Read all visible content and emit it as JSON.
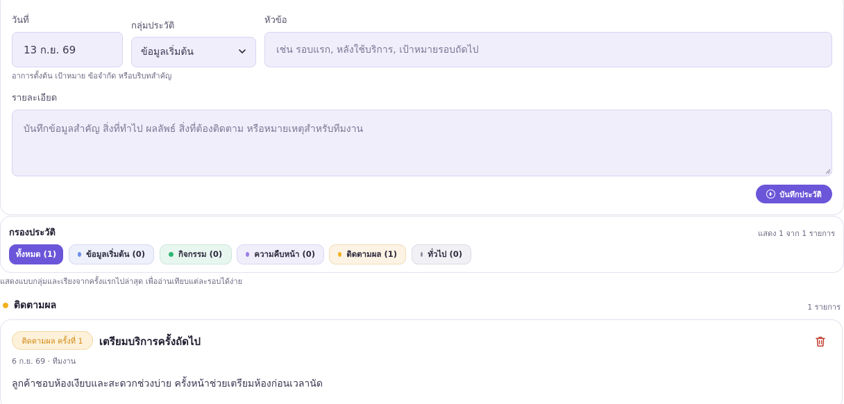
{
  "form": {
    "date_label": "วันที่",
    "date_value": "13 ก.ย. 69",
    "category_label": "กลุ่มประวัติ",
    "category_value": "ข้อมูลเริ่มต้น",
    "topic_label": "หัวข้อ",
    "topic_placeholder": "เช่น รอบแรก, หลังใช้บริการ, เป้าหมายรอบถัดไป",
    "topic_hint": "อาการตั้งต้น เป้าหมาย ข้อจำกัด หรือบริบทสำคัญ",
    "detail_label": "รายละเอียด",
    "detail_placeholder": "บันทึกข้อมูลสำคัญ สิ่งที่ทำไป ผลลัพธ์ สิ่งที่ต้องติดตาม หรือหมายเหตุสำหรับทีมงาน",
    "save_label": "บันทึกประวัติ"
  },
  "filter": {
    "title": "กรองประวัติ",
    "summary": "แสดง 1 จาก 1 รายการ",
    "chips": [
      {
        "label": "ทั้งหมด (1)",
        "dot": ""
      },
      {
        "label": "ข้อมูลเริ่มต้น (0)",
        "dot": "#6b8fe8"
      },
      {
        "label": "กิจกรรม (0)",
        "dot": "#2bb673"
      },
      {
        "label": "ความคืบหน้า (0)",
        "dot": "#9b7fe6"
      },
      {
        "label": "ติดตามผล (1)",
        "dot": "#f2b11f"
      },
      {
        "label": "ทั่วไป (0)",
        "dot": "#8e8a9e"
      }
    ],
    "note": "แสดงแบบกลุ่มและเรียงจากครั้งแรกไปล่าสุด เพื่ออ่านเทียบแต่ละรอบได้ง่าย"
  },
  "group": {
    "title": "ติดตามผล",
    "count": "1 รายการ",
    "color": "#f2b11f"
  },
  "entry": {
    "badge": "ติดตามผล ครั้งที่ 1",
    "title": "เตรียมบริการครั้งถัดไป",
    "meta": "6 ก.ย. 69 · ทีมงาน",
    "body": "ลูกค้าชอบห้องเงียบและสะดวกช่วงบ่าย ครั้งหน้าช่วยเตรียมห้องก่อนเวลานัด"
  },
  "colors": {
    "accent": "#6b56d9",
    "delete": "#c0392b"
  }
}
